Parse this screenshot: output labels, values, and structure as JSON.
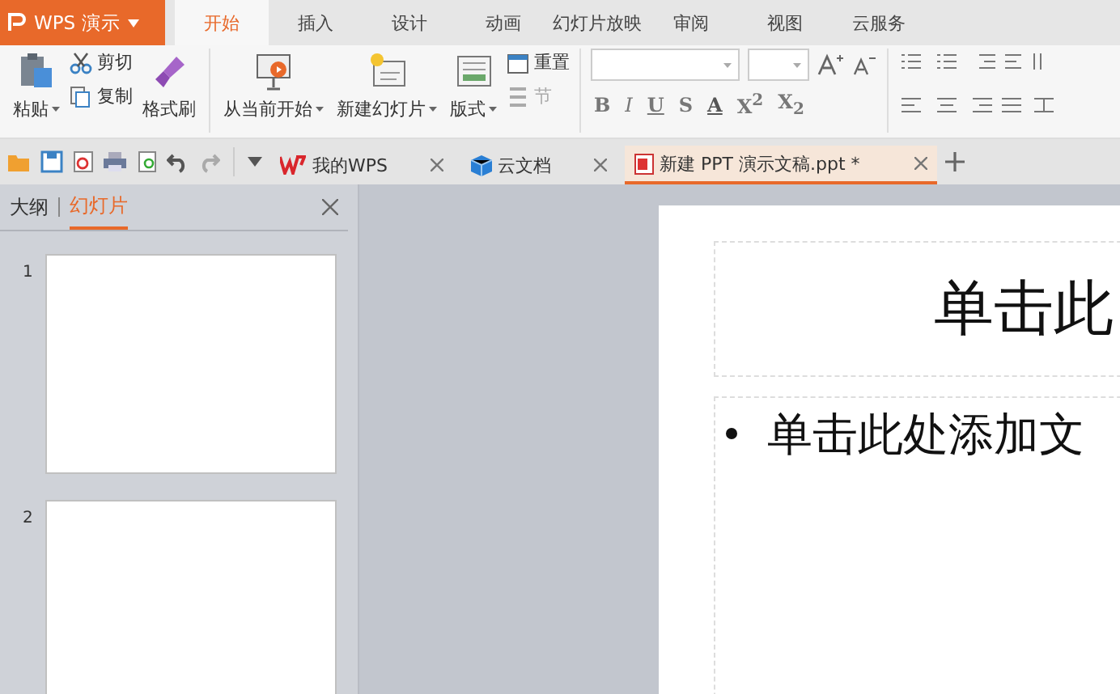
{
  "menu": {
    "app": "WPS 演示",
    "tabs": [
      {
        "label": "开始",
        "selected": true
      },
      {
        "label": "插入",
        "selected": false
      },
      {
        "label": "设计",
        "selected": false
      },
      {
        "label": "动画",
        "selected": false
      },
      {
        "label": "幻灯片放映",
        "selected": false
      },
      {
        "label": "审阅",
        "selected": false
      },
      {
        "label": "视图",
        "selected": false
      },
      {
        "label": "云服务",
        "selected": false
      }
    ]
  },
  "ribbon": {
    "paste": "粘贴",
    "cut": "剪切",
    "copy": "复制",
    "format_painter": "格式刷",
    "from_current": "从当前开始",
    "new_slide": "新建幻灯片",
    "layout": "版式",
    "reset": "重置",
    "section": {
      "label": "节",
      "disabled": true
    },
    "font_buttons": [
      "B",
      "I",
      "U",
      "S",
      "A"
    ],
    "superscript": "X$^{2}$",
    "subscript": "X$_{2}$"
  },
  "doc_tabs": [
    {
      "label": "我的WPS",
      "selected": false
    },
    {
      "label": "云文档",
      "selected": false
    },
    {
      "label": "新建 PPT 演示文稿.ppt *",
      "selected": true
    }
  ],
  "panel": {
    "tabs": [
      {
        "label": "大纲",
        "selected": false
      },
      {
        "label": "幻灯片",
        "selected": true
      }
    ],
    "slides": [
      "1",
      "2"
    ]
  },
  "slide": {
    "title": "单击此",
    "body": "单击此处添加文"
  }
}
